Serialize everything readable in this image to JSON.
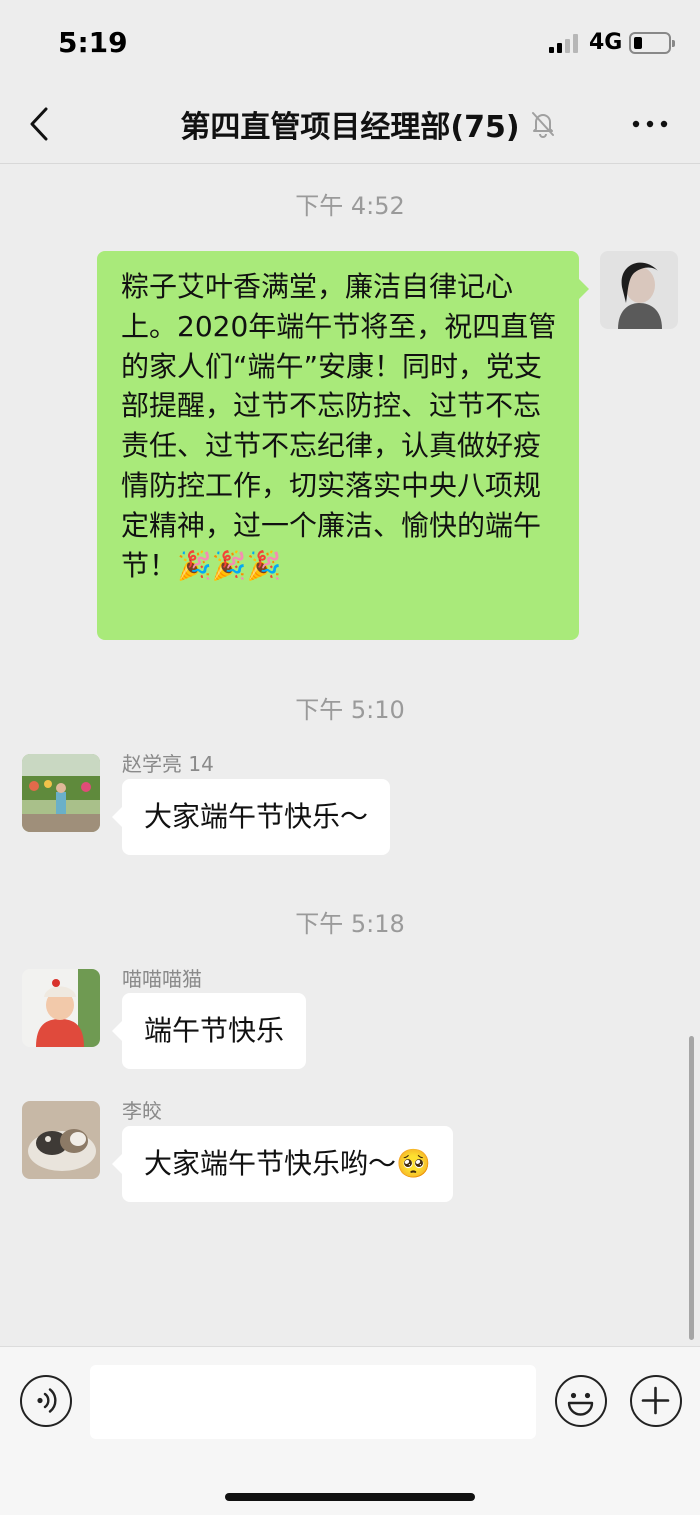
{
  "status": {
    "time": "5:19",
    "network": "4G",
    "battery_level": 0.2
  },
  "nav": {
    "title": "第四直管项目经理部(75)"
  },
  "chat": {
    "timestamps": [
      "下午 4:52",
      "下午 5:10",
      "下午 5:18"
    ],
    "outgoing": {
      "text": "粽子艾叶香满堂，廉洁自律记心上。2020年端午节将至，祝四直管的家人们“端午”安康！同时，党支部提醒，过节不忘防控、过节不忘责任、过节不忘纪律，认真做好疫情防控工作，切实落实中央八项规定精神，过一个廉洁、愉快的端午节！",
      "emoji": [
        "🎉",
        "🎉",
        "🎉"
      ]
    },
    "messages": [
      {
        "sender": "赵学亮 14",
        "text": "大家端午节快乐～"
      },
      {
        "sender": "喵喵喵猫",
        "text": "端午节快乐"
      },
      {
        "sender": "李皎",
        "text": "大家端午节快乐哟～",
        "emoji": "🥺"
      }
    ]
  },
  "input": {
    "placeholder": ""
  },
  "colors": {
    "background": "#ededed",
    "outgoing_bubble": "#a9ea7a",
    "incoming_bubble": "#ffffff"
  }
}
